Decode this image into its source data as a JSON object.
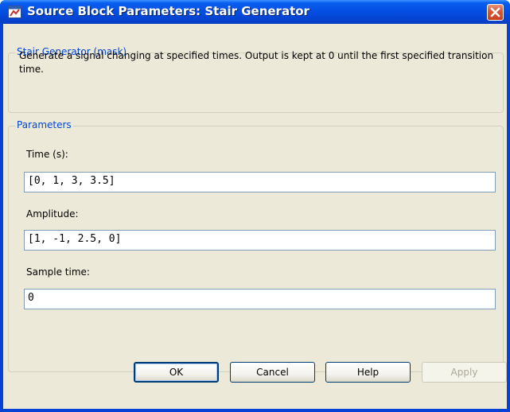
{
  "window": {
    "title": "Source Block Parameters: Stair Generator"
  },
  "mask_group": {
    "legend": "Stair Generator (mask)",
    "description": "Generate a signal changing at specified times. Output is kept at 0 until the first specified transition time."
  },
  "parameters_group": {
    "legend": "Parameters",
    "fields": [
      {
        "label": "Time (s):",
        "value": "[0, 1, 3, 3.5]"
      },
      {
        "label": "Amplitude:",
        "value": "[1, -1, 2.5, 0]"
      },
      {
        "label": "Sample time:",
        "value": "0"
      }
    ]
  },
  "buttons": {
    "ok": "OK",
    "cancel": "Cancel",
    "help": "Help",
    "apply": "Apply"
  },
  "icons": {
    "app": "simulink-block-icon",
    "close": "close-icon"
  },
  "colors": {
    "titlebar": "#0551e6",
    "close_button": "#d8583b",
    "dialog_background": "#ece9d8",
    "group_legend": "#0046d5",
    "input_border": "#7f9db9"
  }
}
